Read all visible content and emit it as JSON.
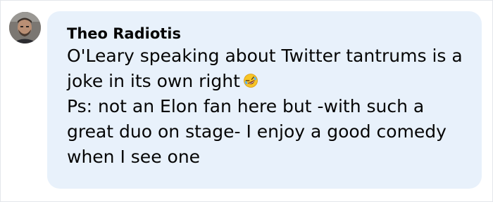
{
  "comment": {
    "author": "Theo Radiotis",
    "line1": "O'Leary speaking about Twitter tantrums is a joke in its own right",
    "emoji_icon": "rolling-on-floor-laughing-emoji",
    "line2": "Ps: not an Elon fan here but -with such a great duo on stage- I enjoy a good comedy when I see one"
  },
  "colors": {
    "bubble_background": "#e8f1fb",
    "text": "#050505"
  }
}
